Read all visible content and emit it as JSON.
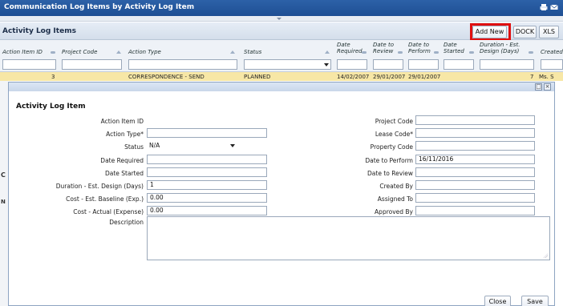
{
  "window": {
    "title": "Communication Log Items by Activity Log Item",
    "icons": [
      "printer-icon",
      "mail-icon"
    ]
  },
  "panel": {
    "title": "Activity Log Items",
    "buttons": {
      "add_new": "Add New",
      "dock": "DOCK",
      "xls": "XLS"
    }
  },
  "grid": {
    "columns": [
      {
        "label": "Action Item ID"
      },
      {
        "label": "Project Code"
      },
      {
        "label": "Action Type"
      },
      {
        "label": "Status"
      },
      {
        "label": "Date Required"
      },
      {
        "label": "Date to Review"
      },
      {
        "label": "Date to Perform"
      },
      {
        "label": "Date Started"
      },
      {
        "label": "Duration - Est. Design (Days)"
      },
      {
        "label": "Created"
      }
    ],
    "row": {
      "id": "3",
      "action_type": "CORRESPONDENCE - SEND",
      "status": "PLANNED",
      "date_required": "14/02/2007",
      "date_to_review": "29/01/2007",
      "date_to_perform": "29/01/2007",
      "duration": "7",
      "created": "Ms. S"
    }
  },
  "side_letters": [
    "C",
    "N"
  ],
  "dialog": {
    "title": "Activity Log Item",
    "left_fields": {
      "action_item_id": {
        "label": "Action Item ID",
        "value": ""
      },
      "action_type": {
        "label": "Action Type*",
        "value": ""
      },
      "status": {
        "label": "Status",
        "value": "N/A"
      },
      "date_required": {
        "label": "Date Required",
        "value": ""
      },
      "date_started": {
        "label": "Date Started",
        "value": ""
      },
      "duration": {
        "label": "Duration - Est. Design (Days)",
        "value": "1"
      },
      "cost_baseline": {
        "label": "Cost - Est. Baseline (Exp.)",
        "value": "0.00"
      },
      "cost_actual": {
        "label": "Cost - Actual (Expense)",
        "value": "0.00"
      },
      "description": {
        "label": "Description",
        "value": ""
      }
    },
    "right_fields": {
      "project_code": {
        "label": "Project Code",
        "value": ""
      },
      "lease_code": {
        "label": "Lease Code*",
        "value": ""
      },
      "property_code": {
        "label": "Property Code",
        "value": ""
      },
      "date_to_perform": {
        "label": "Date to Perform",
        "value": "16/11/2016"
      },
      "date_to_review": {
        "label": "Date to Review",
        "value": ""
      },
      "created_by": {
        "label": "Created By",
        "value": ""
      },
      "assigned_to": {
        "label": "Assigned To",
        "value": ""
      },
      "approved_by": {
        "label": "Approved By",
        "value": ""
      }
    },
    "buttons": {
      "close": "Close",
      "save": "Save"
    }
  }
}
